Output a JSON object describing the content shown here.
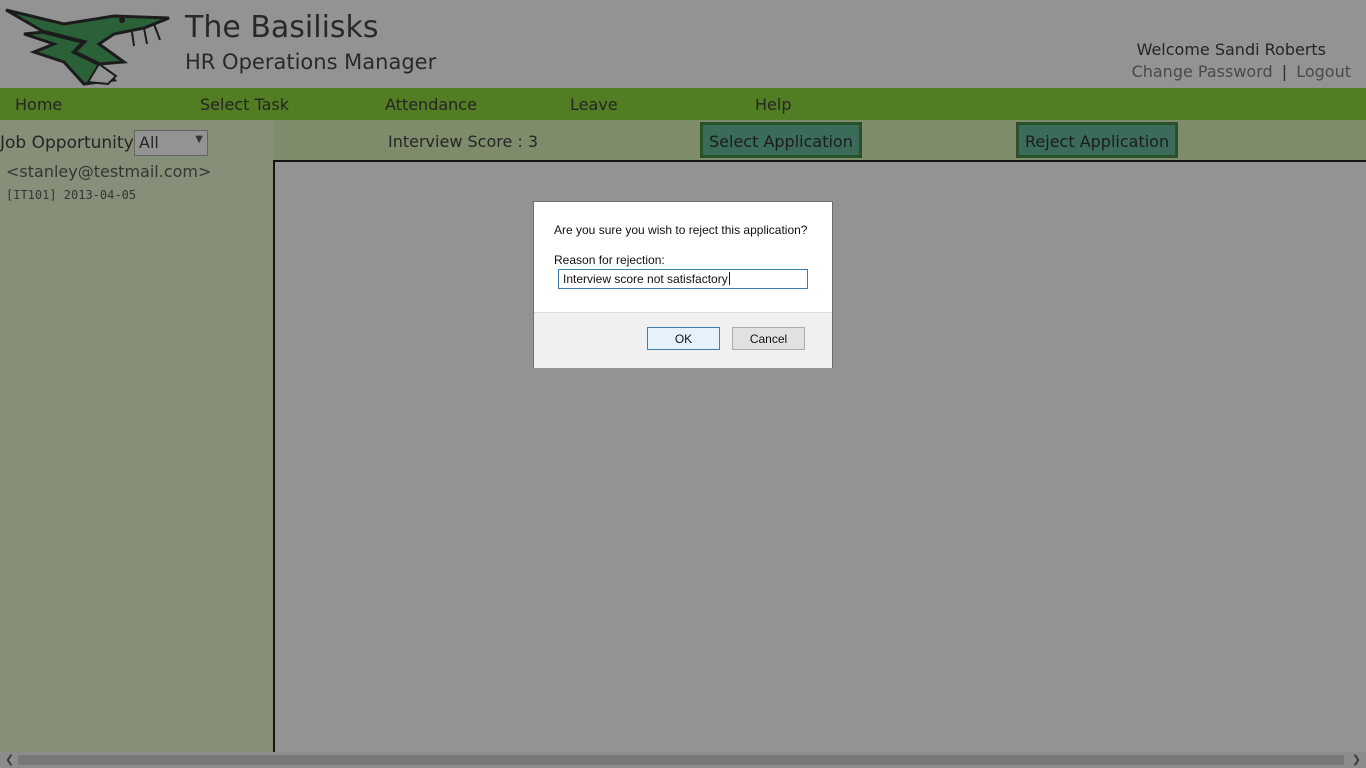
{
  "header": {
    "brand_title": "The Basilisks",
    "brand_subtitle": "HR Operations Manager",
    "welcome": "Welcome Sandi Roberts",
    "change_password": "Change Password",
    "separator": "|",
    "logout": "Logout"
  },
  "nav": {
    "items": [
      {
        "label": "Home"
      },
      {
        "label": "Select Task"
      },
      {
        "label": "Attendance"
      },
      {
        "label": "Leave"
      },
      {
        "label": "Help"
      }
    ]
  },
  "sidebar": {
    "job_label": "Job Opportunity",
    "job_select_value": "All",
    "applicants": [
      {
        "email": "<stanley@testmail.com>",
        "meta": "[IT101] 2013-04-05"
      }
    ]
  },
  "actionbar": {
    "score_text": "Interview Score : 3",
    "select_button": "Select Application",
    "reject_button": "Reject Application"
  },
  "dialog": {
    "message": "Are you sure you wish to reject this application?",
    "reason_label": "Reason for rejection:",
    "reason_value": "Interview score not satisfactory",
    "ok_label": "OK",
    "cancel_label": "Cancel"
  },
  "icons": {
    "logo": "basilisk-snake-logo",
    "scroll_left": "chevron-left-icon",
    "scroll_right": "chevron-right-icon",
    "select_chevron": "chevron-down-icon"
  },
  "colors": {
    "nav_green": "#7cd21c",
    "sidebar_bg": "#e4f6c8",
    "actionbar_bg": "#d6f0b0",
    "action_button_bg": "#4fae8a",
    "action_button_border": "#2a7a2a",
    "dialog_input_border": "#3c7fb1"
  }
}
